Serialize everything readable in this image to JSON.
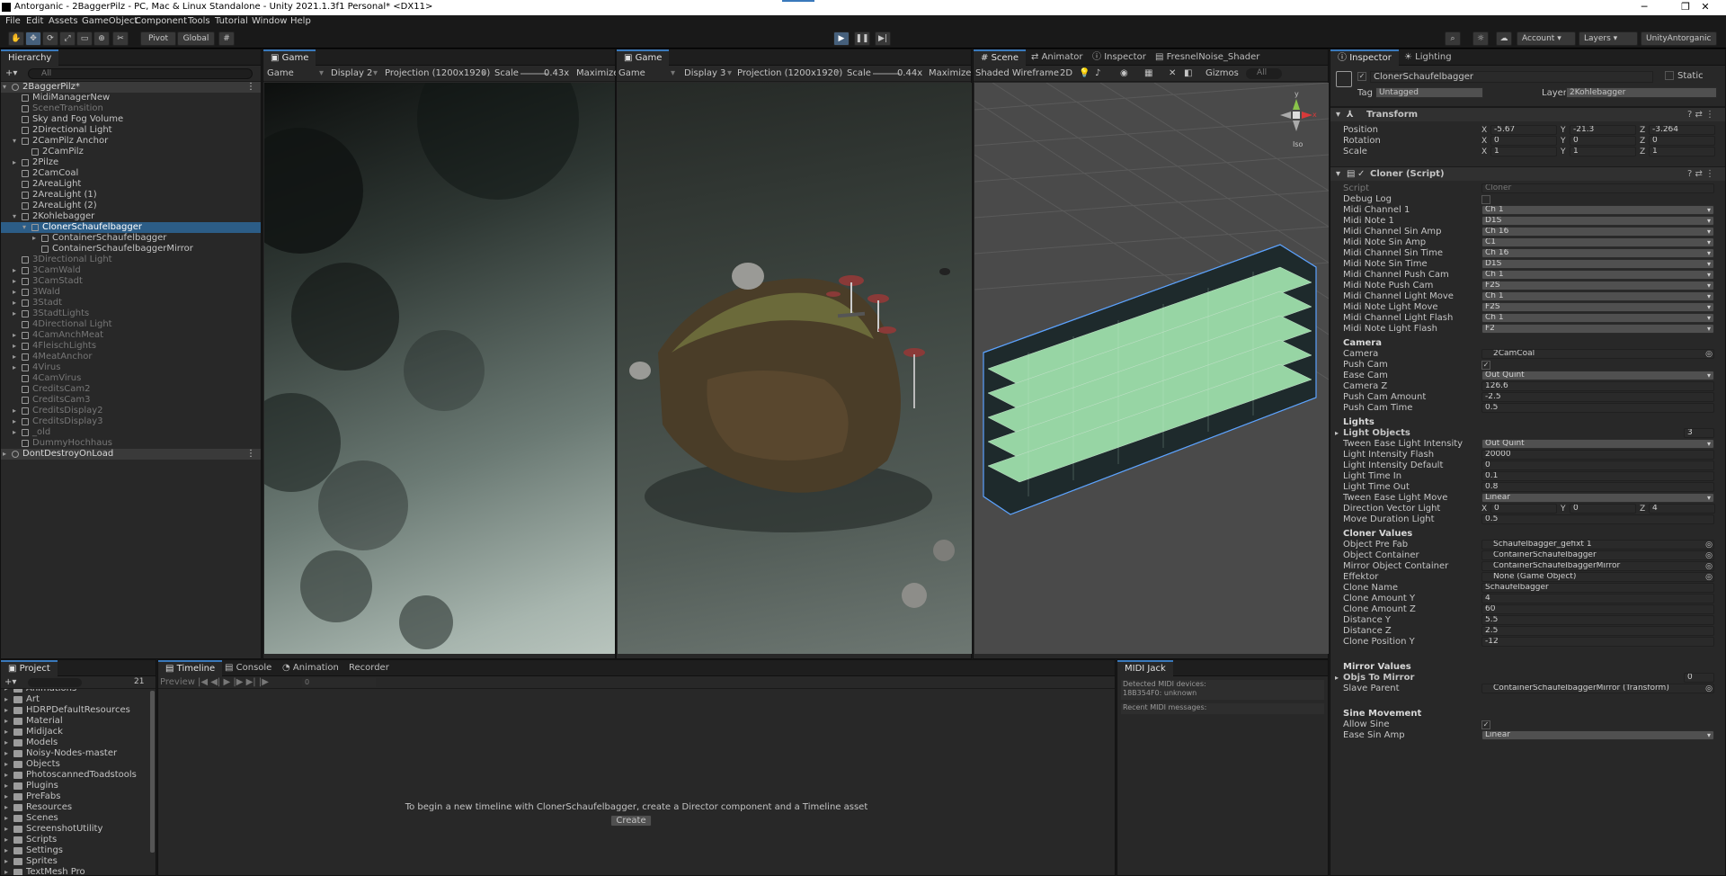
{
  "window": {
    "title": "Antorganic - 2BaggerPilz - PC, Mac & Linux Standalone - Unity 2021.1.3f1 Personal* <DX11>"
  },
  "menu": [
    "File",
    "Edit",
    "Assets",
    "GameObject",
    "Component",
    "Tools",
    "Tutorial",
    "Window",
    "Help"
  ],
  "toolbar": {
    "pivot": "Pivot",
    "global": "Global",
    "account": "Account",
    "layers": "Layers",
    "layout": "UnityAntorganic"
  },
  "hierarchy": {
    "tab": "Hierarchy",
    "search_placeholder": "All",
    "items": [
      {
        "n": "2BaggerPilz*",
        "d": 0,
        "t": "scene",
        "e": "open"
      },
      {
        "n": "MidiManagerNew",
        "d": 1
      },
      {
        "n": "SceneTransition",
        "d": 1,
        "dim": true
      },
      {
        "n": "Sky and Fog Volume",
        "d": 1
      },
      {
        "n": "2Directional Light",
        "d": 1
      },
      {
        "n": "2CamPilz Anchor",
        "d": 1,
        "e": "open"
      },
      {
        "n": "2CamPilz",
        "d": 2
      },
      {
        "n": "2Pilze",
        "d": 1,
        "e": "closed"
      },
      {
        "n": "2CamCoal",
        "d": 1
      },
      {
        "n": "2AreaLight",
        "d": 1
      },
      {
        "n": "2AreaLight (1)",
        "d": 1
      },
      {
        "n": "2AreaLight (2)",
        "d": 1
      },
      {
        "n": "2Kohlebagger",
        "d": 1,
        "e": "open"
      },
      {
        "n": "ClonerSchaufelbagger",
        "d": 2,
        "sel": true,
        "e": "open"
      },
      {
        "n": "ContainerSchaufelbagger",
        "d": 3,
        "e": "closed"
      },
      {
        "n": "ContainerSchaufelbaggerMirror",
        "d": 3
      },
      {
        "n": "3Directional Light",
        "d": 1,
        "dim": true
      },
      {
        "n": "3CamWald",
        "d": 1,
        "dim": true,
        "e": "closed"
      },
      {
        "n": "3CamStadt",
        "d": 1,
        "dim": true,
        "e": "closed"
      },
      {
        "n": "3Wald",
        "d": 1,
        "dim": true,
        "e": "closed"
      },
      {
        "n": "3Stadt",
        "d": 1,
        "dim": true,
        "e": "closed"
      },
      {
        "n": "3StadtLights",
        "d": 1,
        "dim": true,
        "e": "closed"
      },
      {
        "n": "4Directional Light",
        "d": 1,
        "dim": true
      },
      {
        "n": "4CamAnchMeat",
        "d": 1,
        "dim": true,
        "e": "closed"
      },
      {
        "n": "4FleischLights",
        "d": 1,
        "dim": true,
        "e": "closed"
      },
      {
        "n": "4MeatAnchor",
        "d": 1,
        "dim": true,
        "e": "closed"
      },
      {
        "n": "4Virus",
        "d": 1,
        "dim": true,
        "e": "closed"
      },
      {
        "n": "4CamVirus",
        "d": 1,
        "dim": true
      },
      {
        "n": "CreditsCam2",
        "d": 1,
        "dim": true
      },
      {
        "n": "CreditsCam3",
        "d": 1,
        "dim": true
      },
      {
        "n": "CreditsDisplay2",
        "d": 1,
        "dim": true,
        "e": "closed"
      },
      {
        "n": "CreditsDisplay3",
        "d": 1,
        "dim": true,
        "e": "closed"
      },
      {
        "n": "_old",
        "d": 1,
        "dim": true,
        "e": "closed"
      },
      {
        "n": "DummyHochhaus",
        "d": 1,
        "dim": true
      },
      {
        "n": "DontDestroyOnLoad",
        "d": 0,
        "t": "scene",
        "e": "closed"
      }
    ]
  },
  "game1": {
    "tab": "Game",
    "mode": "Game",
    "display": "Display 2",
    "projection": "Projection (1200x1920)",
    "scale_label": "Scale",
    "scale_val": "0.43x",
    "maximize": "Maximize"
  },
  "game2": {
    "tab": "Game",
    "mode": "Game",
    "display": "Display 3",
    "projection": "Projection (1200x1920)",
    "scale_label": "Scale",
    "scale_val": "0.44x",
    "maximize": "Maximize C"
  },
  "scene": {
    "tabs": [
      "Scene",
      "Animator",
      "Inspector",
      "FresnelNoise_Shader"
    ],
    "shading": "Shaded Wireframe",
    "mode2d": "2D",
    "gizmos": "Gizmos",
    "search": "All",
    "iso": "Iso",
    "axis_x": "x",
    "axis_y": "y"
  },
  "inspector": {
    "tabs": [
      "Inspector",
      "Lighting"
    ],
    "object_name": "ClonerSchaufelbagger",
    "static": "Static",
    "tag_label": "Tag",
    "tag": "Untagged",
    "layer_label": "Layer",
    "layer": "2Kohlebagger",
    "transform": {
      "title": "Transform",
      "rows": [
        {
          "label": "Position",
          "x": "-5.67",
          "y": "-21.3",
          "z": "-3.264"
        },
        {
          "label": "Rotation",
          "x": "0",
          "y": "0",
          "z": "0"
        },
        {
          "label": "Scale",
          "x": "1",
          "y": "1",
          "z": "1"
        }
      ]
    },
    "cloner": {
      "title": "Cloner (Script)",
      "script_label": "Script",
      "script": "Cloner"
    },
    "fields": [
      {
        "k": "Debug Log",
        "v": "",
        "t": "check"
      },
      {
        "k": "Midi Channel 1",
        "v": "Ch 1",
        "t": "dd"
      },
      {
        "k": "Midi Note 1",
        "v": "D1S",
        "t": "dd"
      },
      {
        "k": "Midi Channel Sin Amp",
        "v": "Ch 16",
        "t": "dd"
      },
      {
        "k": "Midi Note Sin Amp",
        "v": "C1",
        "t": "dd"
      },
      {
        "k": "Midi Channel Sin Time",
        "v": "Ch 16",
        "t": "dd"
      },
      {
        "k": "Midi Note Sin Time",
        "v": "D1S",
        "t": "dd"
      },
      {
        "k": "Midi Channel Push Cam",
        "v": "Ch 1",
        "t": "dd"
      },
      {
        "k": "Midi Note Push Cam",
        "v": "F2S",
        "t": "dd"
      },
      {
        "k": "Midi Channel Light Move",
        "v": "Ch 1",
        "t": "dd"
      },
      {
        "k": "Midi Note Light Move",
        "v": "F2S",
        "t": "dd"
      },
      {
        "k": "Midi Channel Light Flash",
        "v": "Ch 1",
        "t": "dd"
      },
      {
        "k": "Midi Note Light Flash",
        "v": "F2",
        "t": "dd"
      },
      {
        "k": "Camera",
        "t": "section"
      },
      {
        "k": "Camera",
        "v": "2CamCoal",
        "t": "obj"
      },
      {
        "k": "Push Cam",
        "v": "✓",
        "t": "check"
      },
      {
        "k": "Ease Cam",
        "v": "Out Quint",
        "t": "dd"
      },
      {
        "k": "Camera Z",
        "v": "126.6",
        "t": "text"
      },
      {
        "k": "Push Cam Amount",
        "v": "-2.5",
        "t": "text"
      },
      {
        "k": "Push Cam Time",
        "v": "0.5",
        "t": "text"
      },
      {
        "k": "Lights",
        "t": "section"
      },
      {
        "k": "Light Objects",
        "v": "3",
        "t": "foldout"
      },
      {
        "k": "Tween Ease Light Intensity",
        "v": "Out Quint",
        "t": "dd"
      },
      {
        "k": "Light Intensity Flash",
        "v": "20000",
        "t": "text"
      },
      {
        "k": "Light Intensity Default",
        "v": "0",
        "t": "text"
      },
      {
        "k": "Light Time In",
        "v": "0.1",
        "t": "text"
      },
      {
        "k": "Light Time Out",
        "v": "0.8",
        "t": "text"
      },
      {
        "k": "Tween Ease Light Move",
        "v": "Linear",
        "t": "dd"
      },
      {
        "k": "Direction Vector Light",
        "x": "0",
        "y": "0",
        "z": "4",
        "t": "vec"
      },
      {
        "k": "Move Duration Light",
        "v": "0.5",
        "t": "text"
      },
      {
        "k": "Cloner Values",
        "t": "section"
      },
      {
        "k": "Object Pre Fab",
        "v": "Schaufelbagger_gefixt 1",
        "t": "obj"
      },
      {
        "k": "Object Container",
        "v": "ContainerSchaufelbagger",
        "t": "obj"
      },
      {
        "k": "Mirror Object Container",
        "v": "ContainerSchaufelbaggerMirror",
        "t": "obj"
      },
      {
        "k": "Effektor",
        "v": "None (Game Object)",
        "t": "obj"
      },
      {
        "k": "Clone Name",
        "v": "Schaufelbagger",
        "t": "text"
      },
      {
        "k": "Clone Amount Y",
        "v": "4",
        "t": "text"
      },
      {
        "k": "Clone Amount Z",
        "v": "60",
        "t": "text"
      },
      {
        "k": "Distance Y",
        "v": "5.5",
        "t": "text"
      },
      {
        "k": "Distance Z",
        "v": "2.5",
        "t": "text"
      },
      {
        "k": "Clone Position Y",
        "v": "-12",
        "t": "text"
      },
      {
        "k": "",
        "t": "gap"
      },
      {
        "k": "Mirror Values",
        "t": "section"
      },
      {
        "k": "Objs To Mirror",
        "v": "0",
        "t": "foldout"
      },
      {
        "k": "Slave Parent",
        "v": "ContainerSchaufelbaggerMirror (Transform)",
        "t": "obj"
      },
      {
        "k": "",
        "t": "gap"
      },
      {
        "k": "Sine Movement",
        "t": "section"
      },
      {
        "k": "Allow Sine",
        "v": "✓",
        "t": "check"
      },
      {
        "k": "Ease Sin Amp",
        "v": "Linear",
        "t": "dd"
      }
    ]
  },
  "project": {
    "tab": "Project",
    "count": "21",
    "folders": [
      "Animations",
      "Art",
      "HDRPDefaultResources",
      "Material",
      "MidiJack",
      "Models",
      "Noisy-Nodes-master",
      "Objects",
      "PhotoscannedToadstools",
      "Plugins",
      "PreFabs",
      "Resources",
      "Scenes",
      "ScreenshotUtility",
      "Scripts",
      "Settings",
      "Sprites",
      "TextMesh Pro"
    ]
  },
  "timeline": {
    "tabs": [
      "Timeline",
      "Console",
      "Animation",
      "Recorder"
    ],
    "preview": "Preview",
    "frame": "0",
    "message": "To begin a new timeline with ClonerSchaufelbagger, create a Director component and a Timeline asset",
    "create": "Create"
  },
  "midi": {
    "tab": "MIDI Jack",
    "detected": "Detected MIDI devices:",
    "device": "18B354F0: unknown",
    "recent": "Recent MIDI messages:"
  }
}
